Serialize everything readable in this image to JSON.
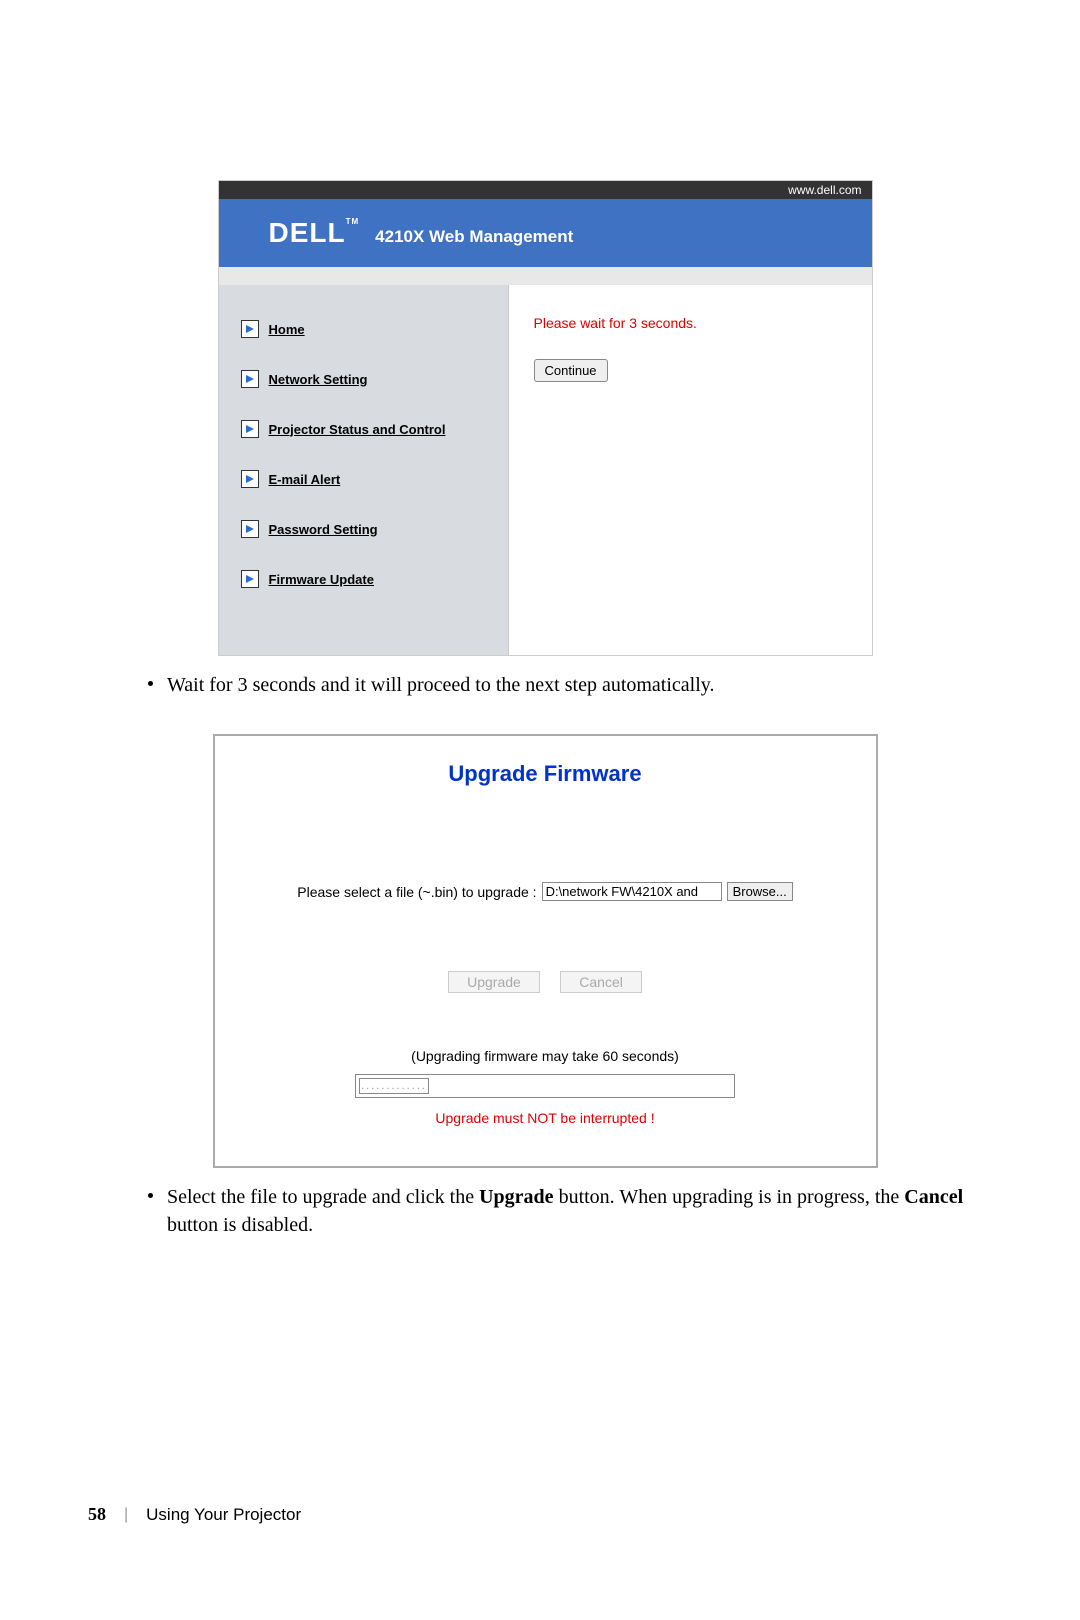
{
  "topbar": {
    "url": "www.dell.com"
  },
  "banner": {
    "logo_text": "DELL",
    "tm": "TM",
    "title": "4210X Web Management"
  },
  "sidebar": {
    "items": [
      "Home",
      "Network Setting",
      "Projector Status and Control",
      "E-mail Alert",
      "Password Setting",
      "Firmware Update"
    ]
  },
  "main": {
    "wait_msg": "Please wait for 3 seconds.",
    "continue_label": "Continue"
  },
  "bullet1": "Wait for 3 seconds and it will proceed to the next step automatically.",
  "upgrade": {
    "title": "Upgrade Firmware",
    "select_label": "Please select a file (~.bin) to upgrade :",
    "file_value": "D:\\network FW\\4210X and",
    "browse_label": "Browse...",
    "upgrade_label": "Upgrade",
    "cancel_label": "Cancel",
    "note": "(Upgrading firmware may take 60 seconds)",
    "progress_dots": ".............",
    "warning": "Upgrade must NOT be interrupted !"
  },
  "bullet2_pre": "Select the file to upgrade and click the ",
  "bullet2_bold1": "Upgrade",
  "bullet2_mid": " button. When upgrading is in progress, the ",
  "bullet2_bold2": "Cancel",
  "bullet2_post": " button is disabled.",
  "footer": {
    "page": "58",
    "separator": "|",
    "section": "Using Your Projector"
  }
}
